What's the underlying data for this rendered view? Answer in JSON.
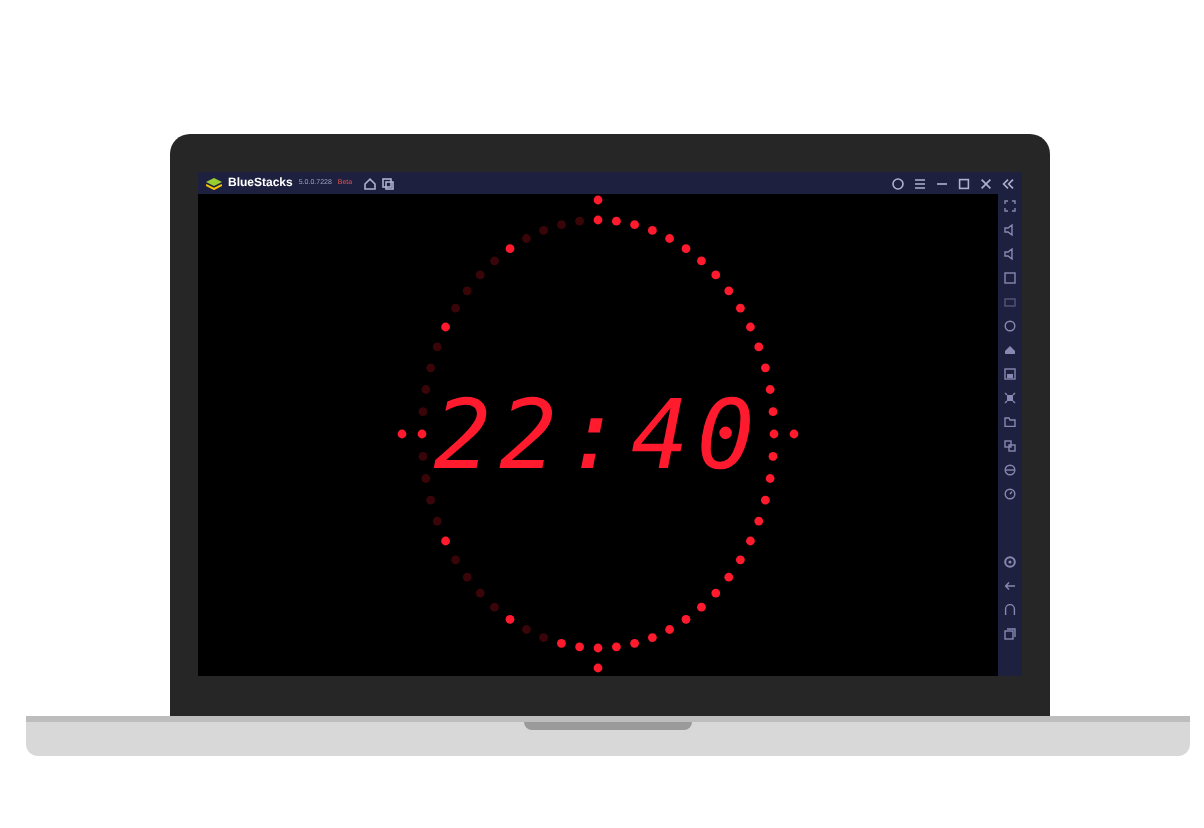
{
  "window": {
    "app_name": "BlueStacks",
    "version": "5.0.0.7228",
    "channel": "Beta"
  },
  "clock": {
    "time": "22:40"
  }
}
